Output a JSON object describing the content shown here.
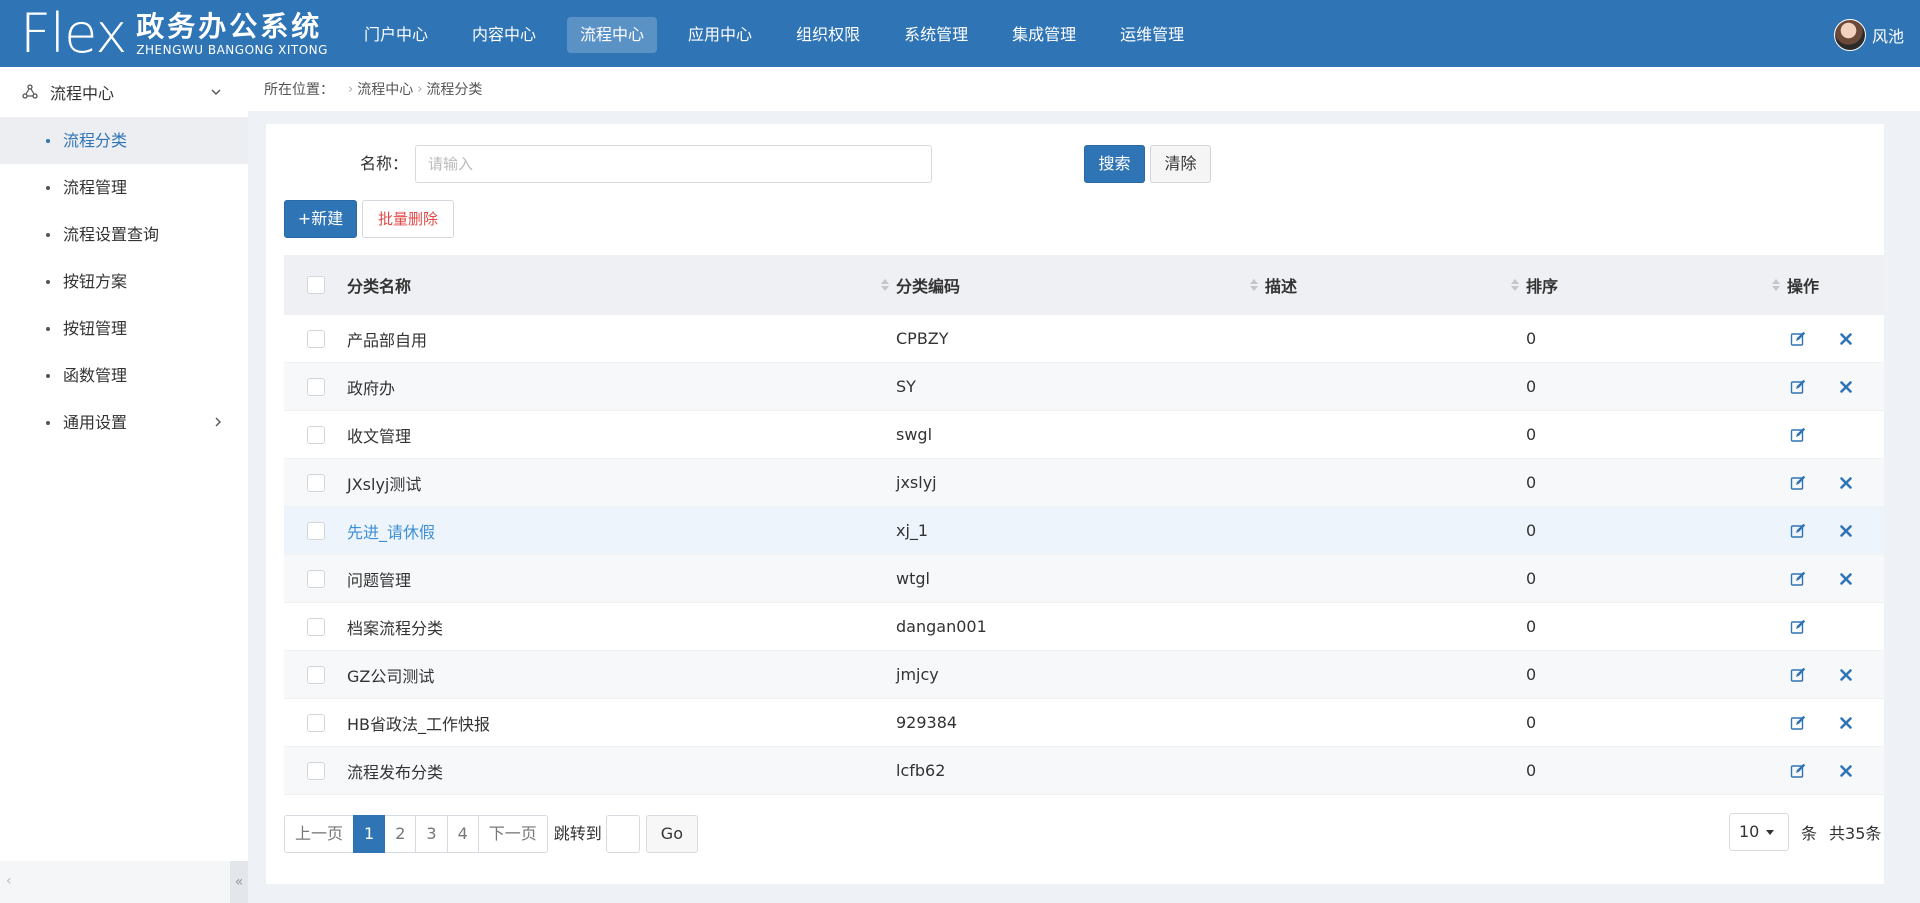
{
  "app": {
    "logo_word": "Flex",
    "title_cn": "政务办公系统",
    "title_en": "ZHENGWU BANGONG XITONG"
  },
  "topnav": [
    {
      "label": "门户中心"
    },
    {
      "label": "内容中心"
    },
    {
      "label": "流程中心",
      "active": true
    },
    {
      "label": "应用中心"
    },
    {
      "label": "组织权限"
    },
    {
      "label": "系统管理"
    },
    {
      "label": "集成管理"
    },
    {
      "label": "运维管理"
    }
  ],
  "user": {
    "name": "风池"
  },
  "sidebar": {
    "section": "流程中心",
    "items": [
      {
        "label": "流程分类",
        "active": true
      },
      {
        "label": "流程管理"
      },
      {
        "label": "流程设置查询"
      },
      {
        "label": "按钮方案"
      },
      {
        "label": "按钮管理"
      },
      {
        "label": "函数管理"
      },
      {
        "label": "通用设置",
        "has_children": true
      }
    ]
  },
  "breadcrumb": {
    "prefix": "所在位置：",
    "items": [
      "流程中心",
      "流程分类"
    ]
  },
  "search": {
    "label": "名称：",
    "placeholder": "请输入",
    "value": "",
    "search_btn": "搜索",
    "clear_btn": "清除"
  },
  "toolbar": {
    "new_btn": "+新建",
    "batch_delete_btn": "批量删除"
  },
  "table": {
    "columns": [
      "分类名称",
      "分类编码",
      "描述",
      "排序",
      "操作"
    ],
    "rows": [
      {
        "name": "产品部自用",
        "code": "CPBZY",
        "desc": "",
        "order": "0",
        "deletable": true
      },
      {
        "name": "政府办",
        "code": "SY",
        "desc": "",
        "order": "0",
        "deletable": true
      },
      {
        "name": "收文管理",
        "code": "swgl",
        "desc": "",
        "order": "0",
        "deletable": false
      },
      {
        "name": "JXslyj测试",
        "code": "jxslyj",
        "desc": "",
        "order": "0",
        "deletable": true
      },
      {
        "name": "先进_请休假",
        "code": "xj_1",
        "desc": "",
        "order": "0",
        "deletable": true,
        "hover": true
      },
      {
        "name": "问题管理",
        "code": "wtgl",
        "desc": "",
        "order": "0",
        "deletable": true
      },
      {
        "name": "档案流程分类",
        "code": "dangan001",
        "desc": "",
        "order": "0",
        "deletable": false
      },
      {
        "name": "GZ公司测试",
        "code": "jmjcy",
        "desc": "",
        "order": "0",
        "deletable": true
      },
      {
        "name": "HB省政法_工作快报",
        "code": "929384",
        "desc": "",
        "order": "0",
        "deletable": true
      },
      {
        "name": "流程发布分类",
        "code": "lcfb62",
        "desc": "",
        "order": "0",
        "deletable": true
      }
    ]
  },
  "pagination": {
    "prev": "上一页",
    "pages": [
      "1",
      "2",
      "3",
      "4"
    ],
    "current": "1",
    "next": "下一页",
    "jump_label": "跳转到",
    "go": "Go",
    "page_size": "10",
    "unit": "条",
    "total": "共35条"
  },
  "colors": {
    "primary": "#2f74b5",
    "danger": "#e34848",
    "link_hover": "#3d8fd6"
  }
}
